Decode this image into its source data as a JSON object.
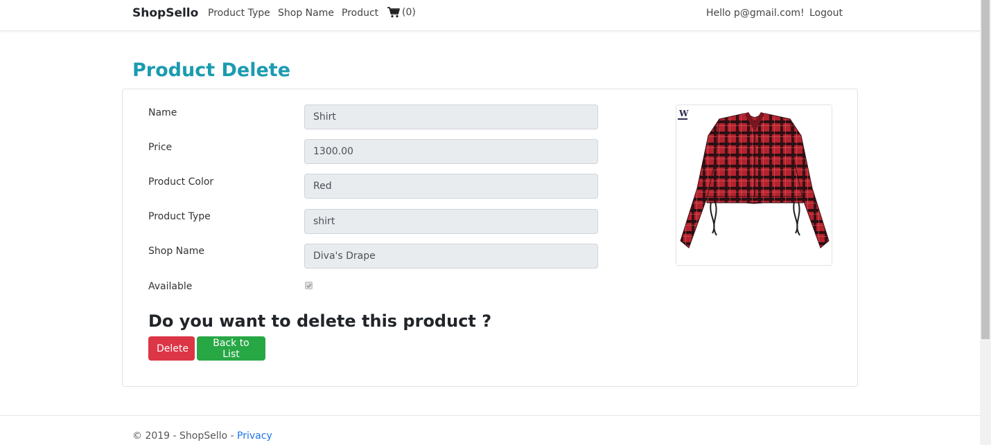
{
  "nav": {
    "brand": "ShopSello",
    "links": [
      "Product Type",
      "Shop Name",
      "Product"
    ],
    "cart_count": "(0)",
    "greeting": "Hello p@gmail.com!",
    "logout": "Logout"
  },
  "page": {
    "title": "Product Delete"
  },
  "form": {
    "fields": [
      {
        "label": "Name",
        "value": "Shirt"
      },
      {
        "label": "Price",
        "value": "1300.00"
      },
      {
        "label": "Product Color",
        "value": "Red"
      },
      {
        "label": "Product Type",
        "value": "shirt"
      },
      {
        "label": "Shop Name",
        "value": "Diva's Drape"
      }
    ],
    "available_label": "Available",
    "available_checked": true,
    "question": "Do you want to delete this product ?",
    "delete_label": "Delete",
    "back_label": "Back to List"
  },
  "image": {
    "icon": "plaid-shirt-image",
    "logo_text": "W"
  },
  "footer": {
    "copyright": "© 2019 - ShopSello - ",
    "privacy": "Privacy"
  },
  "colors": {
    "title": "#1b9bb1",
    "delete": "#dc3545",
    "back": "#28a745",
    "link": "#1a73e8"
  }
}
